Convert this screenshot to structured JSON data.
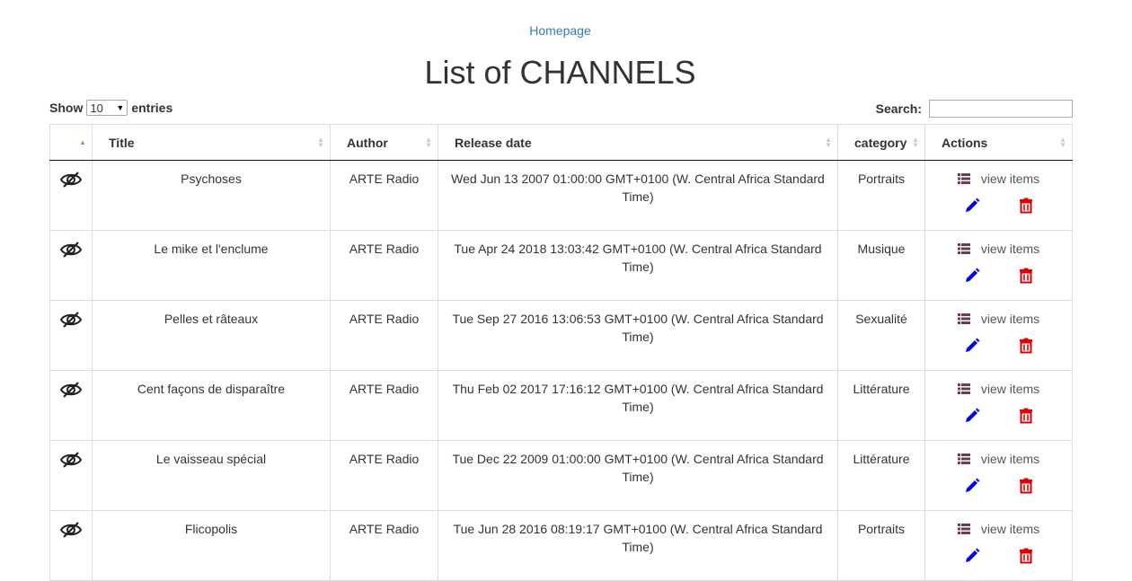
{
  "header": {
    "homepage_link": "Homepage",
    "title": "List of CHANNELS"
  },
  "controls": {
    "show_label": "Show",
    "entries_value": "10",
    "entries_label": "entries",
    "search_label": "Search:",
    "search_value": ""
  },
  "table": {
    "columns": [
      "",
      "Title",
      "Author",
      "Release date",
      "category",
      "Actions"
    ],
    "view_items_label": "view items",
    "rows": [
      {
        "title": "Psychoses",
        "author": "ARTE Radio",
        "release_date": "Wed Jun 13 2007 01:00:00 GMT+0100 (W. Central Africa Standard Time)",
        "category": "Portraits"
      },
      {
        "title": "Le mike et l'enclume",
        "author": "ARTE Radio",
        "release_date": "Tue Apr 24 2018 13:03:42 GMT+0100 (W. Central Africa Standard Time)",
        "category": "Musique"
      },
      {
        "title": "Pelles et râteaux",
        "author": "ARTE Radio",
        "release_date": "Tue Sep 27 2016 13:06:53 GMT+0100 (W. Central Africa Standard Time)",
        "category": "Sexualité"
      },
      {
        "title": "Cent façons de disparaître",
        "author": "ARTE Radio",
        "release_date": "Thu Feb 02 2017 17:16:12 GMT+0100 (W. Central Africa Standard Time)",
        "category": "Littérature"
      },
      {
        "title": "Le vaisseau spécial",
        "author": "ARTE Radio",
        "release_date": "Tue Dec 22 2009 01:00:00 GMT+0100 (W. Central Africa Standard Time)",
        "category": "Littérature"
      },
      {
        "title": "Flicopolis",
        "author": "ARTE Radio",
        "release_date": "Tue Jun 28 2016 08:19:17 GMT+0100 (W. Central Africa Standard Time)",
        "category": "Portraits"
      }
    ]
  },
  "colors": {
    "link": "#337ab7",
    "edit_icon": "#0000ee",
    "delete_icon": "#e00000",
    "list_icon": "#6b3b4e"
  },
  "icons": {
    "row_toggle": "eye-slash-icon",
    "view_items": "list-icon",
    "edit": "pencil-icon",
    "delete": "trash-icon"
  }
}
